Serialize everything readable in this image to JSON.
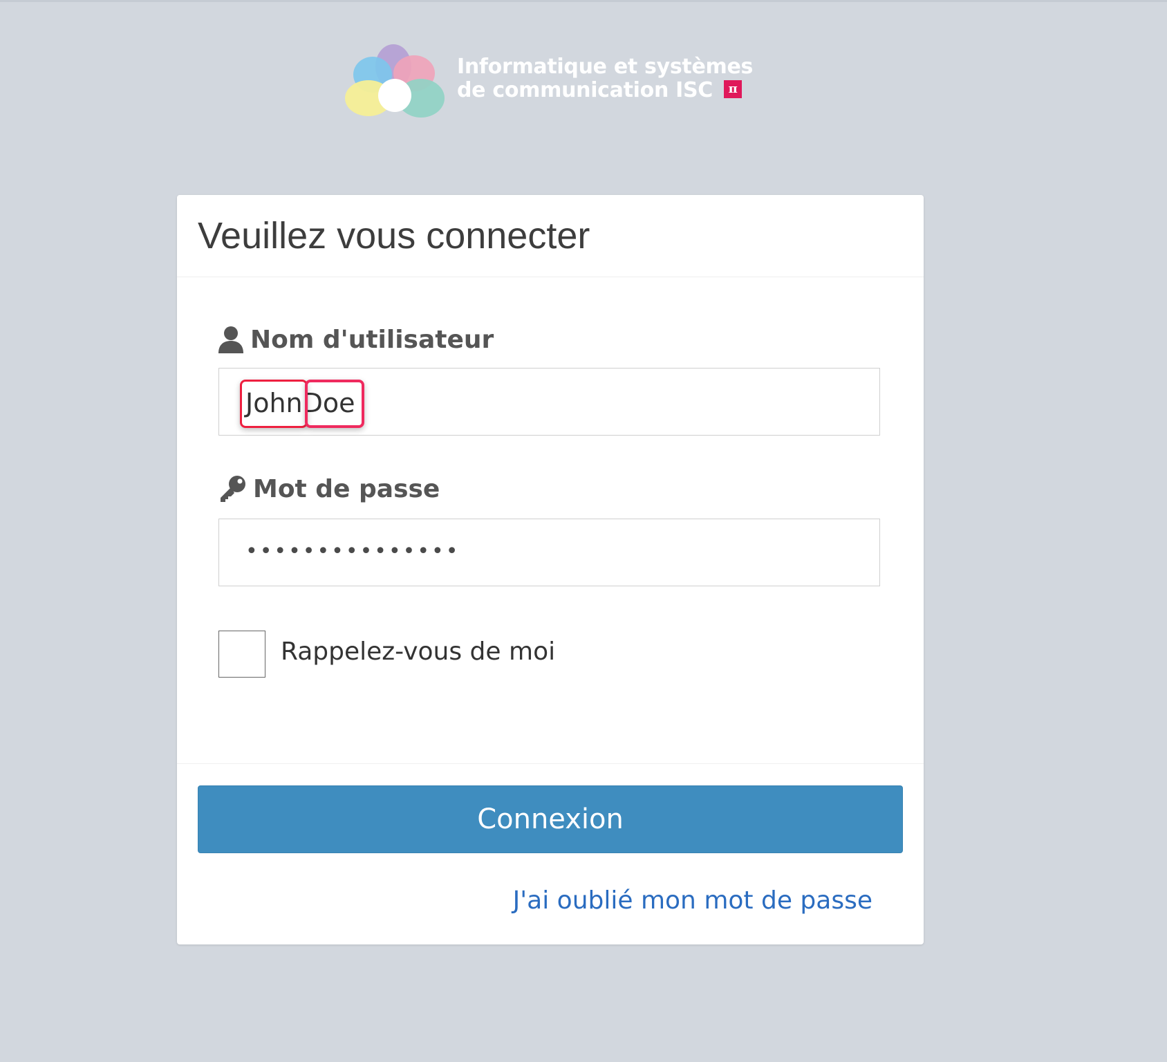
{
  "brand": {
    "name_line1": "Informatique et systèmes",
    "name_line2": "de communication ISC",
    "badge": "π"
  },
  "login_form": {
    "title": "Veuillez vous connecter",
    "username_label": "Nom d'utilisateur",
    "username_value": "JohnDoe",
    "password_label": "Mot de passe",
    "password_mask": "•••••••••••••••",
    "remember_label": "Rappelez-vous de moi",
    "remember_checked": false,
    "submit_label": "Connexion",
    "forgot_link": "J'ai oublié mon mot de passe"
  },
  "colors": {
    "page_background": "#d2d7de",
    "button_primary": "#3f8dbf",
    "link": "#2a6cc0",
    "highlight": "#ee1f3f",
    "badge": "#e0185a"
  },
  "icons": {
    "username": "user-icon",
    "password": "key-icon"
  }
}
